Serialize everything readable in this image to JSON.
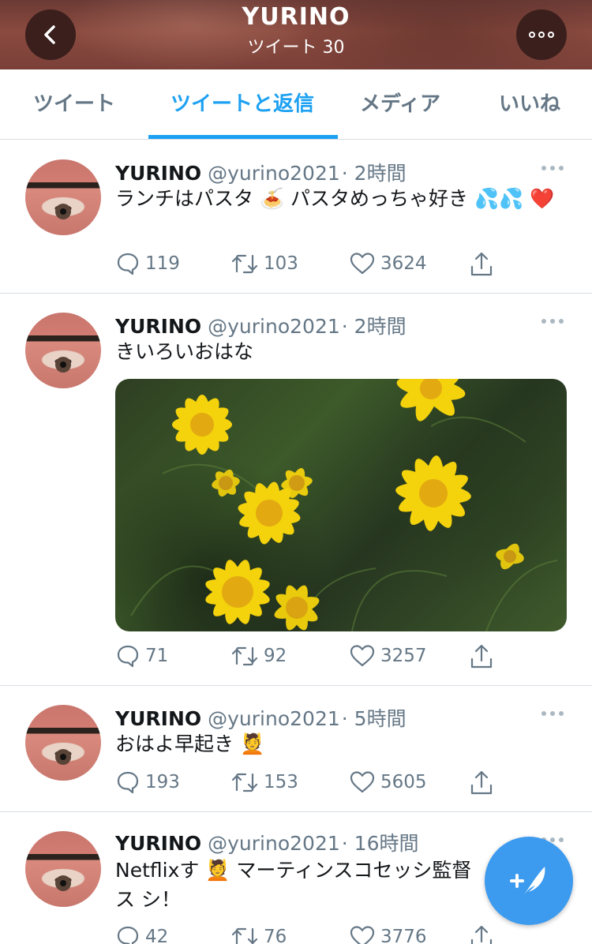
{
  "header": {
    "title": "YURINO",
    "subtitle": "ツイート 30"
  },
  "tabs": [
    {
      "label": "ツイート",
      "active": false
    },
    {
      "label": "ツイートと返信",
      "active": true
    },
    {
      "label": "メディア",
      "active": false
    },
    {
      "label": "いいね",
      "active": false
    }
  ],
  "tweets": [
    {
      "name": "YURINO",
      "handle": "@yurino2021",
      "time": "· 2時間",
      "text": "ランチはパスタ 🍝 パスタめっちゃ好き 💦💦 ❤️",
      "replies": "119",
      "retweets": "103",
      "likes": "3624"
    },
    {
      "name": "YURINO",
      "handle": "@yurino2021",
      "time": "· 2時間",
      "text": "きいろいおはな",
      "replies": "71",
      "retweets": "92",
      "likes": "3257"
    },
    {
      "name": "YURINO",
      "handle": "@yurino2021",
      "time": "· 5時間",
      "text": "おはよ早起き 💆",
      "replies": "193",
      "retweets": "153",
      "likes": "5605"
    },
    {
      "name": "YURINO",
      "handle": "@yurino2021",
      "time": "· 16時間",
      "text": "Netflixす 💆 マーティンスコセッシ監督ス シ！",
      "replies": "42",
      "retweets": "76",
      "likes": "3776"
    }
  ],
  "colors": {
    "accent": "#1da1f2",
    "fab": "#3c9bef",
    "muted": "#657786"
  },
  "icons": {
    "back": "chevron-left-icon",
    "more": "more-icon",
    "compose": "compose-tweet-icon"
  }
}
